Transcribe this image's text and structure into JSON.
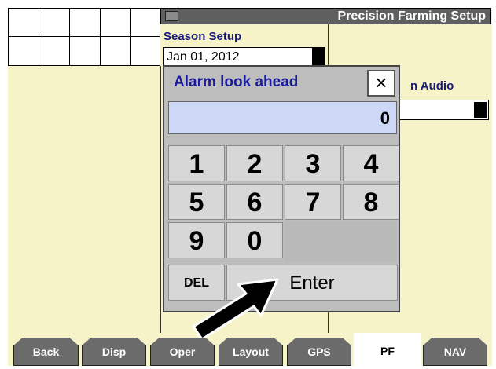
{
  "header": {
    "title": "Precision Farming Setup",
    "app_icon": "monitor-icon"
  },
  "season": {
    "label": "Season Setup",
    "value": "Jan 01, 2012"
  },
  "audio": {
    "label_visible": "n Audio",
    "value": ""
  },
  "dialog": {
    "title": "Alarm look ahead",
    "close_symbol": "×",
    "display_value": "0",
    "keys": [
      "1",
      "2",
      "3",
      "4",
      "5",
      "6",
      "7",
      "8",
      "9",
      "0"
    ],
    "del_label": "DEL",
    "enter_label": "Enter"
  },
  "tabs": [
    {
      "label": "Back"
    },
    {
      "label": "Disp"
    },
    {
      "label": "Oper"
    },
    {
      "label": "Layout"
    },
    {
      "label": "GPS"
    },
    {
      "label": "PF",
      "active": true
    },
    {
      "label": "NAV"
    }
  ],
  "colors": {
    "screen_bg": "#f7f3c9",
    "dialog_bg": "#bdbdbd",
    "display_bg": "#ccd8f6",
    "label_blue": "#1a1a7a"
  }
}
